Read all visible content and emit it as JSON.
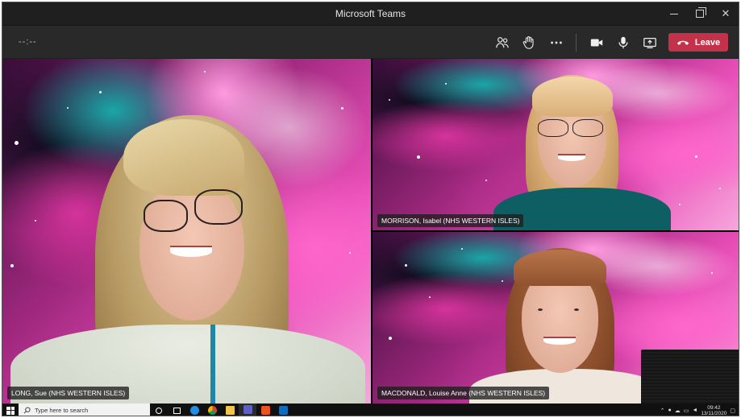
{
  "window": {
    "title": "Microsoft Teams",
    "minimize_glyph": "—",
    "close_glyph": "✕"
  },
  "toolbar": {
    "timer": "--:--",
    "leave_label": "Leave",
    "leave_color": "#c4314b",
    "buttons": [
      "participants-icon",
      "raise-hand-icon",
      "more-options-icon",
      "camera-icon",
      "microphone-icon",
      "share-screen-icon"
    ]
  },
  "participants": [
    {
      "name": "LONG, Sue (NHS WESTERN ISLES)"
    },
    {
      "name": "MORRISON, Isabel (NHS WESTERN ISLES)"
    },
    {
      "name": "MACDONALD, Louise Anne (NHS WESTERN ISLES)"
    }
  ],
  "taskbar": {
    "search_placeholder": "Type here to search",
    "time": "09:42",
    "date": "13/11/2020",
    "apps": [
      "task-view-icon",
      "edge-icon",
      "chrome-icon",
      "file-explorer-icon",
      "teams-icon",
      "office-icon",
      "outlook-icon"
    ]
  }
}
